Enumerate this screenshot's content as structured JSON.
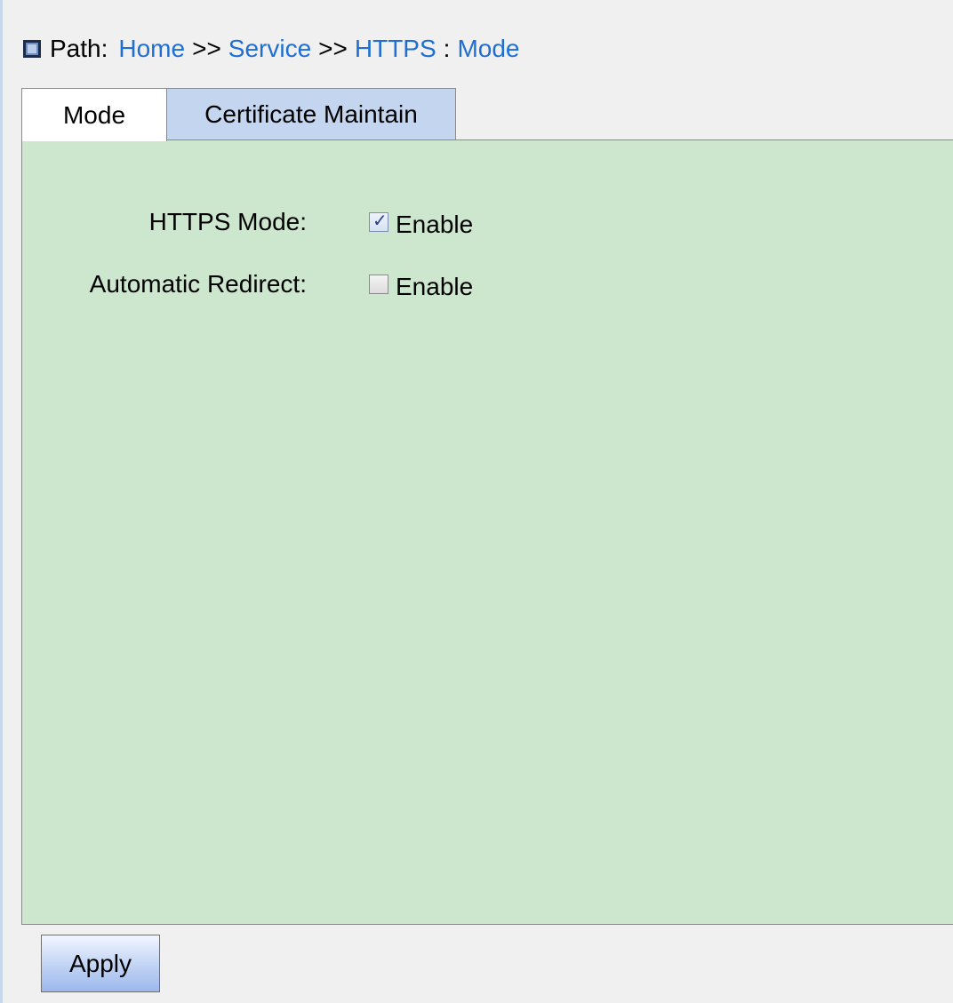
{
  "breadcrumb": {
    "label": "Path:",
    "items": [
      "Home",
      "Service",
      "HTTPS"
    ],
    "separator": ">>",
    "current": "Mode"
  },
  "tabs": [
    {
      "label": "Mode",
      "active": true
    },
    {
      "label": "Certificate Maintain",
      "active": false
    }
  ],
  "form": {
    "https_mode": {
      "label": "HTTPS Mode:",
      "option": "Enable",
      "checked": true
    },
    "auto_redirect": {
      "label": "Automatic Redirect:",
      "option": "Enable",
      "checked": false
    }
  },
  "actions": {
    "apply_label": "Apply"
  },
  "colors": {
    "panel_bg": "#cde7cf",
    "inactive_tab_bg": "#c4d6ef",
    "link": "#1f6fd3"
  }
}
